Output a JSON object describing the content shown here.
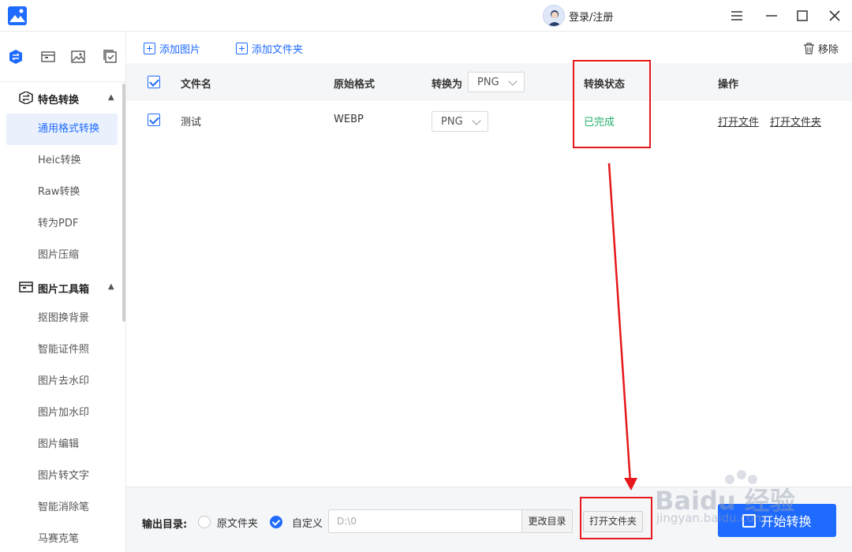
{
  "titlebar": {
    "login_label": "登录/注册"
  },
  "toolbar": {
    "add_image": "添加图片",
    "add_folder": "添加文件夹",
    "remove": "移除"
  },
  "sidebar": {
    "groups": [
      {
        "label": "特色转换",
        "items": [
          "通用格式转换",
          "Heic转换",
          "Raw转换",
          "转为PDF",
          "图片压缩"
        ]
      },
      {
        "label": "图片工具箱",
        "items": [
          "抠图换背景",
          "智能证件照",
          "图片去水印",
          "图片加水印",
          "图片编辑",
          "图片转文字",
          "智能消除笔",
          "马赛克笔"
        ]
      }
    ],
    "active_item": "通用格式转换"
  },
  "table": {
    "headers": {
      "filename": "文件名",
      "source_format": "原始格式",
      "convert_to": "转换为",
      "convert_to_value": "PNG",
      "status": "转换状态",
      "actions": "操作"
    },
    "rows": [
      {
        "filename": "测试",
        "source_format": "WEBP",
        "target_format": "PNG",
        "status": "已完成",
        "action_open_file": "打开文件",
        "action_open_folder": "打开文件夹"
      }
    ]
  },
  "bottom": {
    "output_label": "输出目录:",
    "option_original": "原文件夹",
    "option_custom": "自定义",
    "selected_option": "自定义",
    "path_value": "D:\\0",
    "change_dir": "更改目录",
    "open_folder": "打开文件夹",
    "start": "开始转换"
  },
  "colors": {
    "accent": "#1f6bff",
    "success": "#27b06e",
    "highlight": "#e5181c",
    "header_bg": "#f5f6f8"
  },
  "watermark": {
    "text": "Baidu 经验",
    "sub": "jingyan.baidu.com"
  }
}
